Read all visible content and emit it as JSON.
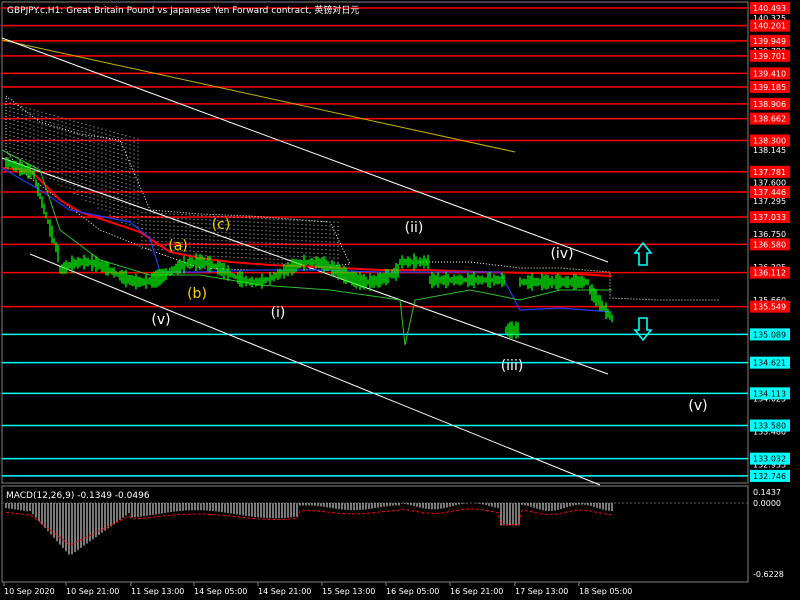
{
  "header": {
    "title": "GBPJPY.c,H1: Great Britain Pound vs Japanese Yen Forward contract, 英镑对日元"
  },
  "colors": {
    "background": "#000000",
    "candles": "#00ff00",
    "hline_red": "#ff0000",
    "hline_cyan": "#00ffff",
    "channel": "#ffffff",
    "trend_yellow": "#c8b400",
    "ma_red": "#ff0000",
    "ma_blue": "#1e3cff",
    "wave_white": "#ffffff",
    "wave_yellow": "#ffd000",
    "arrows": "#00ffff",
    "macd_hist": "#c8c8c8",
    "macd_signal": "#ff0000"
  },
  "price_axis": {
    "ticks": [
      "140.325",
      "139.780",
      "139.235",
      "138.690",
      "138.145",
      "137.600",
      "137.295",
      "136.750",
      "136.205",
      "135.660",
      "135.115",
      "134.570",
      "134.025",
      "133.480",
      "132.935"
    ],
    "levels": [
      {
        "value": "140.493",
        "color": "red"
      },
      {
        "value": "140.201",
        "color": "red"
      },
      {
        "value": "139.949",
        "color": "red"
      },
      {
        "value": "139.701",
        "color": "red"
      },
      {
        "value": "139.410",
        "color": "red"
      },
      {
        "value": "139.185",
        "color": "red"
      },
      {
        "value": "138.906",
        "color": "red"
      },
      {
        "value": "138.662",
        "color": "red"
      },
      {
        "value": "138.300",
        "color": "red"
      },
      {
        "value": "137.781",
        "color": "red"
      },
      {
        "value": "137.446",
        "color": "red"
      },
      {
        "value": "137.033",
        "color": "red"
      },
      {
        "value": "136.580",
        "color": "red"
      },
      {
        "value": "136.112",
        "color": "red"
      },
      {
        "value": "135.549",
        "color": "red"
      },
      {
        "value": "135.089",
        "color": "cyan"
      },
      {
        "value": "134.621",
        "color": "cyan"
      },
      {
        "value": "134.113",
        "color": "cyan"
      },
      {
        "value": "133.580",
        "color": "cyan"
      },
      {
        "value": "133.032",
        "color": "cyan"
      },
      {
        "value": "132.746",
        "color": "cyan"
      }
    ]
  },
  "time_axis": [
    "10 Sep 2020",
    "10 Sep 21:00",
    "11 Sep 13:00",
    "14 Sep 05:00",
    "14 Sep 21:00",
    "15 Sep 13:00",
    "16 Sep 05:00",
    "16 Sep 21:00",
    "17 Sep 13:00",
    "18 Sep 05:00"
  ],
  "wave_labels": [
    {
      "text": "(a)",
      "color": "yellow"
    },
    {
      "text": "(b)",
      "color": "yellow"
    },
    {
      "text": "(c)",
      "color": "yellow"
    },
    {
      "text": "(v)",
      "color": "white"
    },
    {
      "text": "(i)",
      "color": "white"
    },
    {
      "text": "(ii)",
      "color": "white"
    },
    {
      "text": "(iii)",
      "color": "white"
    },
    {
      "text": "(iv)",
      "color": "white"
    },
    {
      "text": "(v)",
      "color": "white"
    }
  ],
  "macd": {
    "label": "MACD(12,26,9) -0.1349 -0.0496",
    "ticks": [
      "0.1437",
      "0.0000",
      "-0.6228"
    ]
  },
  "icons": [
    "arrow-up-icon",
    "arrow-down-icon"
  ]
}
